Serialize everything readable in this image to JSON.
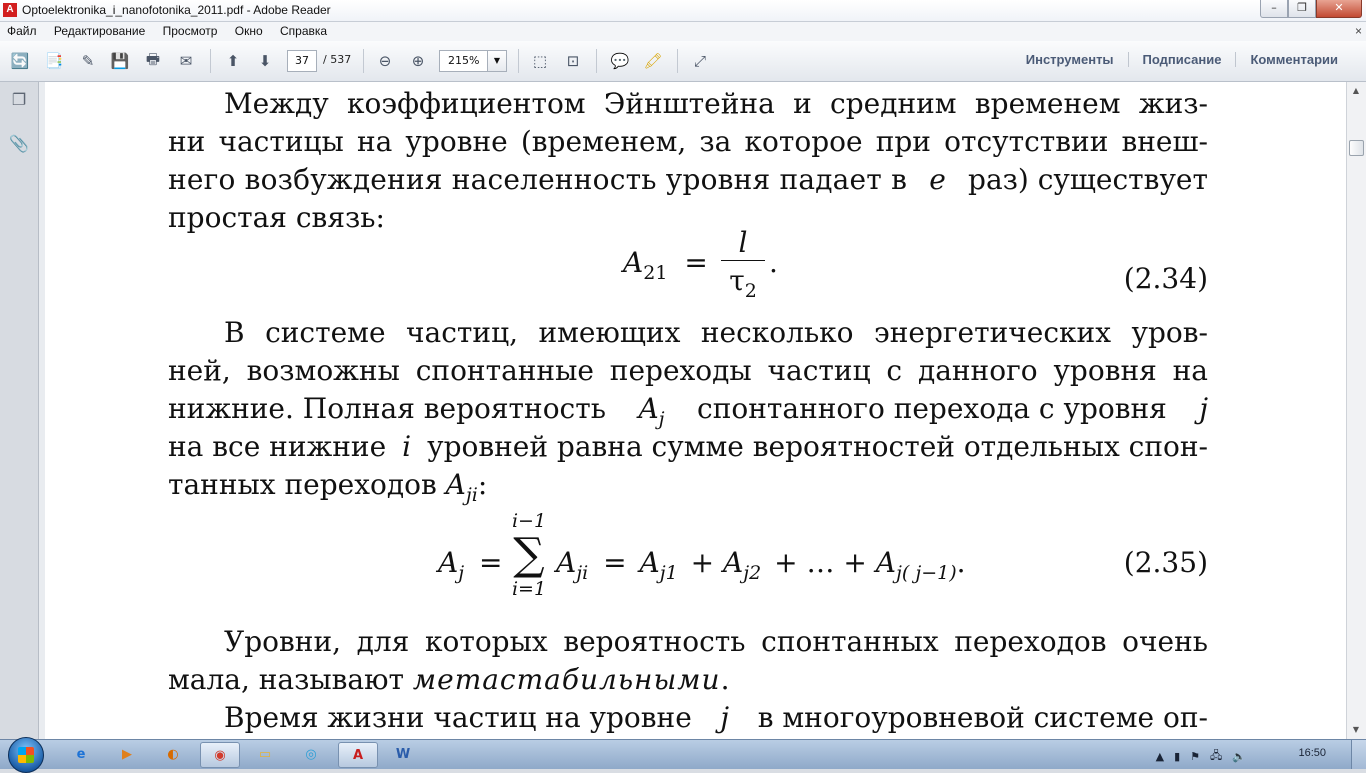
{
  "window": {
    "title": "Optoelektronika_i_nanofotonika_2011.pdf - Adobe Reader",
    "app_icon": "adobe-reader-icon",
    "buttons": [
      "minimize",
      "maximize",
      "close"
    ]
  },
  "menu": {
    "items": [
      "Файл",
      "Редактирование",
      "Просмотр",
      "Окно",
      "Справка"
    ],
    "close_glyph": "×"
  },
  "toolbar": {
    "current_page": "37",
    "total_pages": "/ 537",
    "zoom": "215%",
    "links": [
      "Инструменты",
      "Подписание",
      "Комментарии"
    ]
  },
  "document": {
    "p1": [
      "Между коэффициентом Эйнштейна и средним временем жиз-",
      "ни частицы на уровне (временем, за которое при отсутствии внеш-",
      "него возбуждения населенность уровня падает в",
      "e",
      "раз) существует",
      "простая связь:"
    ],
    "eq1": {
      "lhs": "A",
      "lhs_sub": "21",
      "eq": "=",
      "num": "l",
      "den": "τ",
      "den_sub": "2",
      "end": ".",
      "number": "(2.34)"
    },
    "p2": [
      "В системе частиц, имеющих несколько энергетических уров-",
      "ней, возможны спонтанные переходы частиц с данного уровня на",
      "нижние. Полная вероятность",
      "A",
      "j",
      "спонтанного перехода с уровня",
      "j",
      "на все нижние",
      "i",
      "уровней равна сумме вероятностей отдельных спон-",
      "танных переходов",
      "A",
      "ji",
      ":"
    ],
    "eq2": {
      "lhs": "A",
      "lhs_sub": "j",
      "eq1": "=",
      "sum_top": "i−1",
      "sum_sym": "∑",
      "sum_bot": "i=1",
      "term": "A",
      "term_sub": "ji",
      "eq2": "=",
      "t1": "A",
      "t1_sub": "j1",
      "plus1": "+",
      "t2": "A",
      "t2_sub": "j2",
      "plus2": "+",
      "dots": "…",
      "plus3": "+",
      "t3": "A",
      "t3_sub": "j( j−1)",
      "end": ".",
      "number": "(2.35)"
    },
    "p3": [
      "Уровни, для которых вероятность спонтанных переходов очень",
      "мала, называют",
      "метастабильными",
      "."
    ],
    "p4": [
      "Время жизни частиц на уровне",
      "j",
      "в многоуровневой системе оп-"
    ]
  },
  "taskbar": {
    "apps": [
      "internet-explorer-icon",
      "media-player-icon",
      "winamp-icon",
      "chrome-icon",
      "explorer-folder-icon",
      "network-app-icon",
      "adobe-reader-icon",
      "word-icon"
    ],
    "clock": "16:50"
  }
}
